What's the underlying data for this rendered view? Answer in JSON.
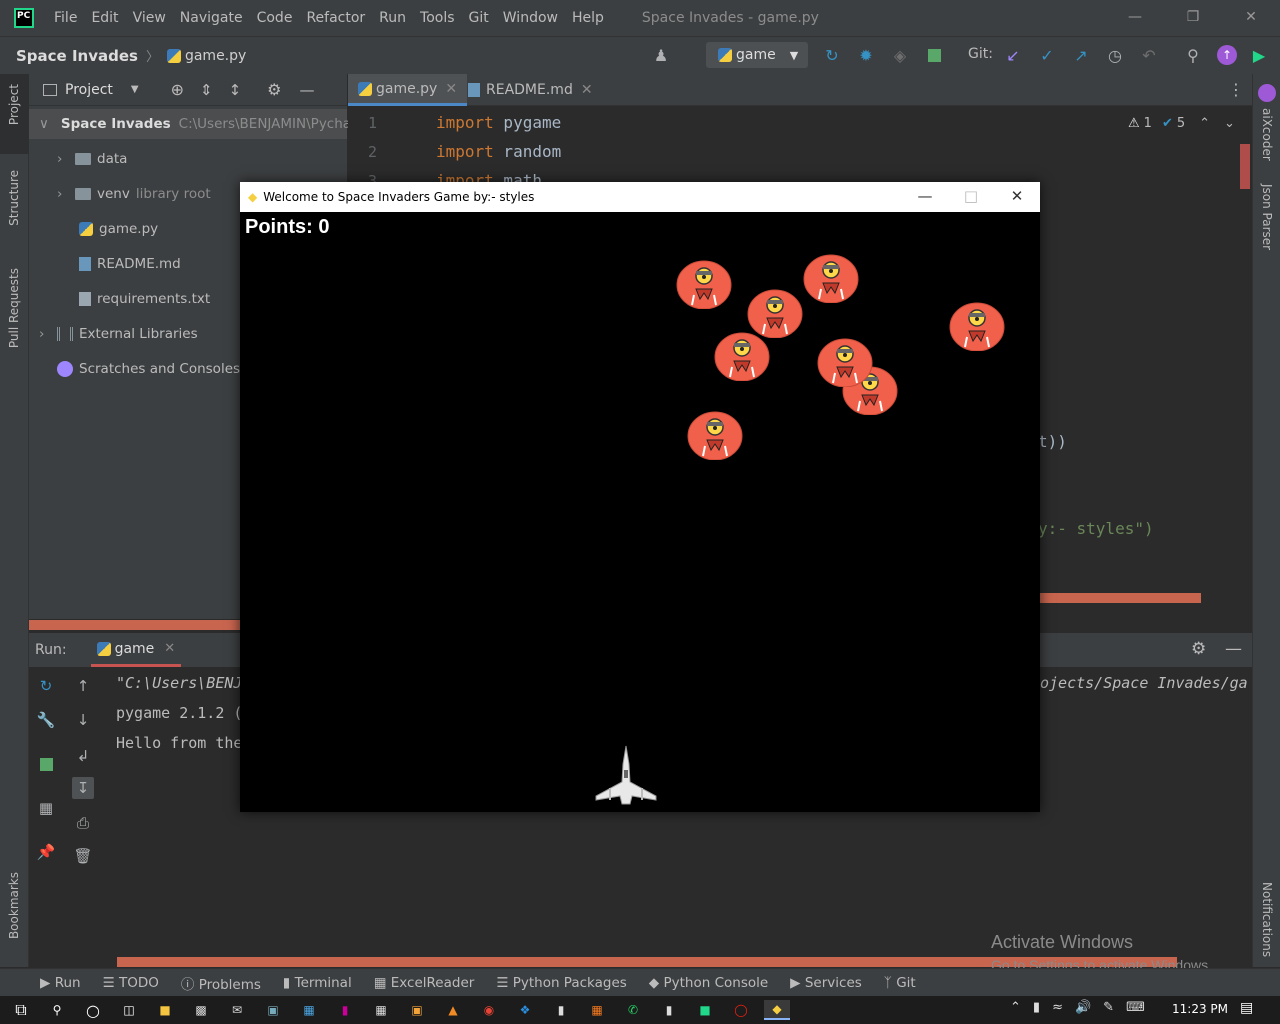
{
  "menubar": {
    "items": [
      "File",
      "Edit",
      "View",
      "Navigate",
      "Code",
      "Refactor",
      "Run",
      "Tools",
      "Git",
      "Window",
      "Help"
    ],
    "title": "Space Invades - game.py"
  },
  "navbar": {
    "project": "Space Invades",
    "file": "game.py",
    "run_config": "game",
    "git_label": "Git:"
  },
  "project_panel": {
    "title": "Project",
    "tree": {
      "root_name": "Space Invades",
      "root_path": "C:\\Users\\BENJAMIN\\Pycha",
      "data": "data",
      "venv": "venv",
      "venv_hint": "library root",
      "game": "game.py",
      "readme": "README.md",
      "req": "requirements.txt",
      "ext": "External Libraries",
      "scratch": "Scratches and Consoles"
    }
  },
  "editor": {
    "tabs": [
      "game.py",
      "README.md"
    ],
    "line_numbers": [
      "1",
      "2",
      "3"
    ],
    "lines": [
      {
        "kw": "import",
        "rest": " pygame"
      },
      {
        "kw": "import",
        "rest": " random"
      },
      {
        "kw": "import",
        "rest": " math"
      }
    ],
    "frag1": "t))",
    "frag2": "y:- styles\")",
    "warnings": "1",
    "checks": "5"
  },
  "run_panel": {
    "label": "Run:",
    "tab": "game",
    "output": [
      "\"C:\\Users\\BENJ",
      "pygame 2.1.2 (",
      "Hello from the"
    ],
    "output_right": "ojects/Space Invades/ga"
  },
  "left_stripe": [
    "Project",
    "Structure",
    "Pull Requests",
    "Bookmarks"
  ],
  "right_stripe": [
    "aiXcoder",
    "Json Parser",
    "Notifications"
  ],
  "tool_tabs": [
    "Run",
    "TODO",
    "Problems",
    "Terminal",
    "ExcelReader",
    "Python Packages",
    "Python Console",
    "Services",
    "Git"
  ],
  "game": {
    "title": "Welcome to Space Invaders Game by:- styles",
    "points_label": "Points: 0"
  },
  "watermark": {
    "title": "Activate Windows",
    "subtitle": "Go to Settings to activate Windows."
  },
  "taskbar": {
    "time": "11:23 PM"
  }
}
